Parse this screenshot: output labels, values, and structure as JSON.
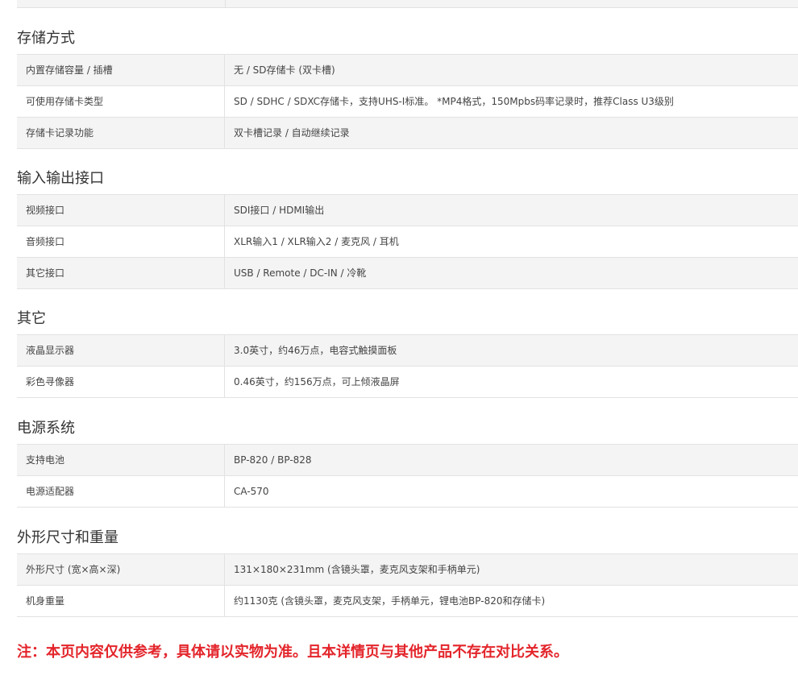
{
  "sections": [
    {
      "title": "存储方式",
      "rows": [
        {
          "key": "内置存储容量 / 插槽",
          "value": "无 / SD存储卡 (双卡槽)"
        },
        {
          "key": "可使用存储卡类型",
          "value": "SD / SDHC / SDXC存储卡，支持UHS-I标准。 *MP4格式，150Mpbs码率记录时，推荐Class U3级别"
        },
        {
          "key": "存储卡记录功能",
          "value": "双卡槽记录 / 自动继续记录"
        }
      ]
    },
    {
      "title": "输入输出接口",
      "rows": [
        {
          "key": "视频接口",
          "value": "SDI接口 / HDMI输出"
        },
        {
          "key": "音频接口",
          "value": "XLR输入1 / XLR输入2 / 麦克风 / 耳机"
        },
        {
          "key": "其它接口",
          "value": "USB / Remote / DC-IN / 冷靴"
        }
      ]
    },
    {
      "title": "其它",
      "rows": [
        {
          "key": "液晶显示器",
          "value": "3.0英寸，约46万点，电容式触摸面板"
        },
        {
          "key": "彩色寻像器",
          "value": "0.46英寸，约156万点，可上倾液晶屏"
        }
      ]
    },
    {
      "title": "电源系统",
      "rows": [
        {
          "key": "支持电池",
          "value": "BP-820 / BP-828"
        },
        {
          "key": "电源适配器",
          "value": "CA-570"
        }
      ]
    },
    {
      "title": "外形尺寸和重量",
      "rows": [
        {
          "key": "外形尺寸 (宽×高×深)",
          "value": "131×180×231mm (含镜头罩，麦克风支架和手柄单元)"
        },
        {
          "key": "机身重量",
          "value": "约1130克 (含镜头罩，麦克风支架，手柄单元，锂电池BP-820和存储卡)"
        }
      ]
    }
  ],
  "note": "注：本页内容仅供参考，具体请以实物为准。且本详情页与其他产品不存在对比关系。",
  "colors": {
    "note": "#e3252b",
    "row_shade": "#f4f4f4",
    "border": "#e2e2e2",
    "text": "#333333"
  }
}
